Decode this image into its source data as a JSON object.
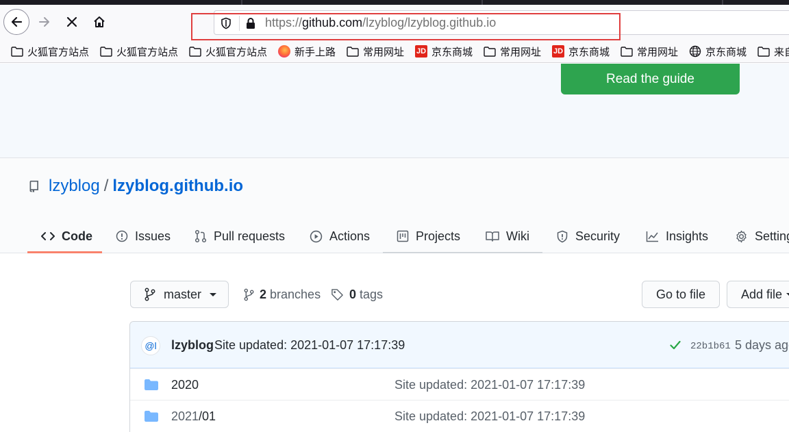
{
  "browser": {
    "address": {
      "prefix": "https://",
      "host": "github.com",
      "path": "/lzyblog/lzyblog.github.io"
    },
    "bookmarks": [
      {
        "label": "火狐官方站点",
        "icon": "folder-icon"
      },
      {
        "label": "火狐官方站点",
        "icon": "folder-icon"
      },
      {
        "label": "火狐官方站点",
        "icon": "folder-icon"
      },
      {
        "label": "新手上路",
        "icon": "firefox-icon"
      },
      {
        "label": "常用网址",
        "icon": "folder-icon"
      },
      {
        "label": "京东商城",
        "icon": "jd-icon"
      },
      {
        "label": "常用网址",
        "icon": "folder-icon"
      },
      {
        "label": "京东商城",
        "icon": "jd-icon"
      },
      {
        "label": "常用网址",
        "icon": "folder-icon"
      },
      {
        "label": "京东商城",
        "icon": "globe-icon"
      },
      {
        "label": "来自",
        "icon": "folder-icon"
      }
    ],
    "jd_badge": "JD"
  },
  "banner": {
    "button_label": "Read the guide",
    "button_color": "#2ea44f"
  },
  "repo": {
    "owner": "lzyblog",
    "separator": "/",
    "name": "lzyblog.github.io",
    "tabs": [
      {
        "label": "Code",
        "icon": "code-icon",
        "active": true
      },
      {
        "label": "Issues",
        "icon": "issue-icon"
      },
      {
        "label": "Pull requests",
        "icon": "pull-request-icon"
      },
      {
        "label": "Actions",
        "icon": "play-icon"
      },
      {
        "label": "Projects",
        "icon": "project-icon"
      },
      {
        "label": "Wiki",
        "icon": "book-icon"
      },
      {
        "label": "Security",
        "icon": "shield-icon"
      },
      {
        "label": "Insights",
        "icon": "graph-icon"
      },
      {
        "label": "Settings",
        "icon": "gear-icon"
      }
    ],
    "accent_color": "#f9826c"
  },
  "filenav": {
    "branch": "master",
    "branches_count": "2",
    "branches_label": "branches",
    "tags_count": "0",
    "tags_label": "tags",
    "go_to_file": "Go to file",
    "add_file": "Add file"
  },
  "commit": {
    "avatar_text": "@l",
    "author": "lzyblog",
    "message": "Site updated: 2021-01-07 17:17:39",
    "sha": "22b1b61",
    "time": "5 days ago"
  },
  "files": [
    {
      "name": "2020",
      "name_suffix": "",
      "message": "Site updated: 2021-01-07 17:17:39"
    },
    {
      "name": "2021",
      "name_suffix": "/01",
      "message": "Site updated: 2021-01-07 17:17:39"
    }
  ]
}
